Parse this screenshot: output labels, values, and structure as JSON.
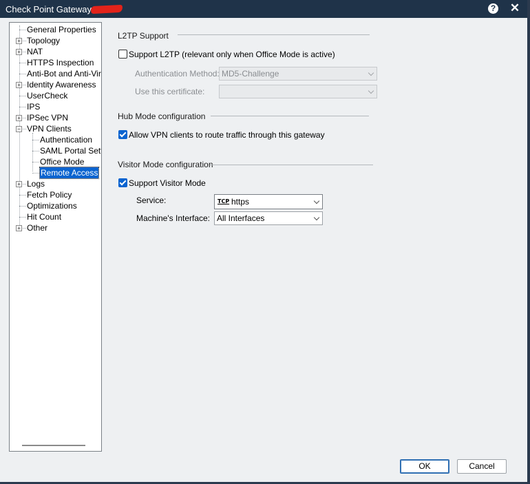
{
  "window": {
    "title": "Check Point Gateway - ",
    "help_glyph": "?",
    "close_glyph": "✕"
  },
  "tree": {
    "items": [
      {
        "label": "General Properties",
        "expander": ""
      },
      {
        "label": "Topology",
        "expander": "+"
      },
      {
        "label": "NAT",
        "expander": "+"
      },
      {
        "label": "HTTPS Inspection",
        "expander": ""
      },
      {
        "label": "Anti-Bot and Anti-Virus",
        "expander": ""
      },
      {
        "label": "Identity Awareness",
        "expander": "+"
      },
      {
        "label": "UserCheck",
        "expander": ""
      },
      {
        "label": "IPS",
        "expander": ""
      },
      {
        "label": "IPSec VPN",
        "expander": "+"
      },
      {
        "label": "VPN Clients",
        "expander": "−"
      },
      {
        "label": "Authentication",
        "expander": ""
      },
      {
        "label": "SAML Portal Settin",
        "expander": ""
      },
      {
        "label": "Office Mode",
        "expander": ""
      },
      {
        "label": "Remote Access",
        "expander": "",
        "selected": true
      },
      {
        "label": "Logs",
        "expander": "+"
      },
      {
        "label": "Fetch Policy",
        "expander": ""
      },
      {
        "label": "Optimizations",
        "expander": ""
      },
      {
        "label": "Hit Count",
        "expander": ""
      },
      {
        "label": "Other",
        "expander": "+"
      }
    ]
  },
  "l2tp": {
    "section_title": "L2TP Support",
    "support_label": "Support L2TP (relevant only when Office Mode is active)",
    "support_checked": false,
    "auth_method_label": "Authentication Method:",
    "auth_method_value": "MD5-Challenge",
    "certificate_label": "Use this certificate:",
    "certificate_value": ""
  },
  "hub": {
    "section_title": "Hub Mode configuration",
    "allow_label": "Allow VPN clients to route traffic through this gateway",
    "allow_checked": true
  },
  "visitor": {
    "section_title": "Visitor Mode configuration",
    "support_label": "Support Visitor Mode",
    "support_checked": true,
    "service_label": "Service:",
    "service_protocol": "TCP",
    "service_value": "https",
    "interface_label": "Machine's Interface:",
    "interface_value": "All Interfaces"
  },
  "buttons": {
    "ok": "OK",
    "cancel": "Cancel"
  }
}
